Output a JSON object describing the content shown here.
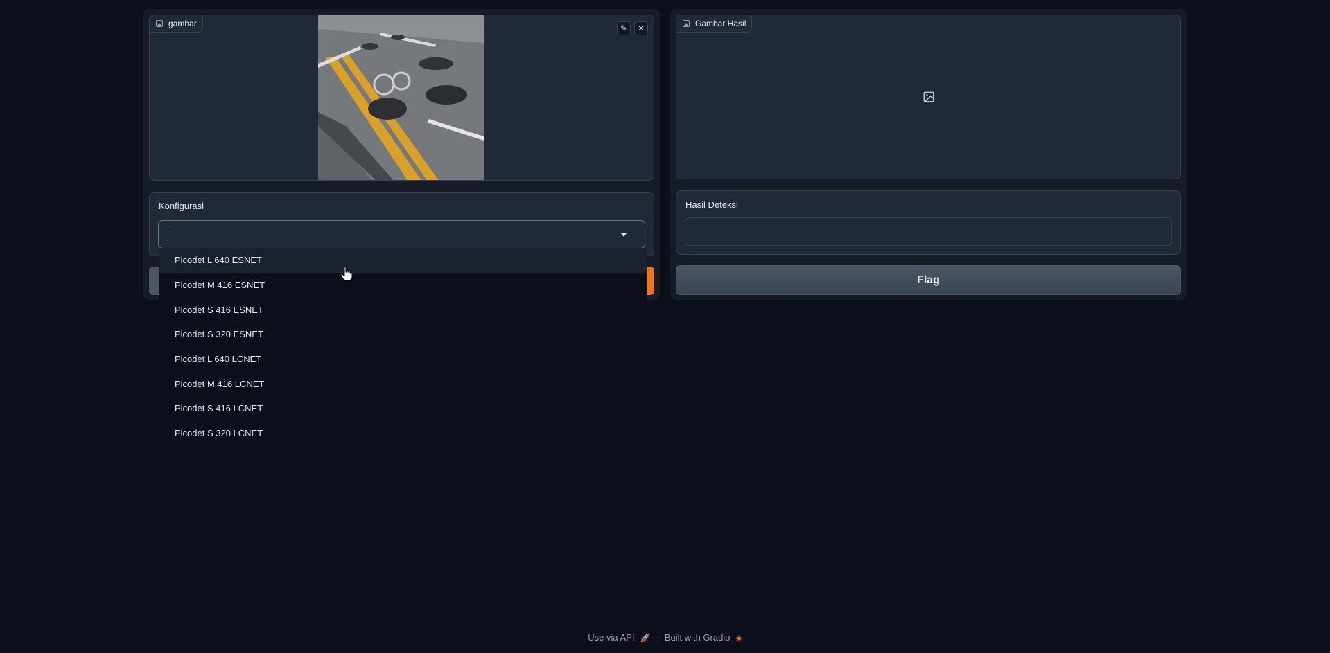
{
  "left_panel": {
    "input_image": {
      "label": "gambar",
      "label_icon": "image-icon",
      "edit_icon": "pencil-icon",
      "close_icon": "close-icon",
      "photo_description_icon": "uploaded-road-photo"
    },
    "config": {
      "label": "Konfigurasi",
      "value": "",
      "options": [
        "Picodet L 640 ESNET",
        "Picodet M 416 ESNET",
        "Picodet S 416 ESNET",
        "Picodet S 320 ESNET",
        "Picodet L 640 LCNET",
        "Picodet M 416 LCNET",
        "Picodet S 416 LCNET",
        "Picodet S 320 LCNET"
      ],
      "hovered_option": "Picodet L 640 ESNET"
    }
  },
  "right_panel": {
    "output_image": {
      "label": "Gambar Hasil",
      "label_icon": "image-icon",
      "empty_icon": "image-placeholder-icon"
    },
    "result": {
      "label": "Hasil Deteksi",
      "value": ""
    },
    "flag_button": "Flag"
  },
  "footer": {
    "api_link": "Use via API",
    "separator": "·",
    "built_with": "Built with Gradio"
  },
  "colors": {
    "background": "#0b0f19",
    "panel": "#1f2937",
    "accent": "#f97316"
  }
}
